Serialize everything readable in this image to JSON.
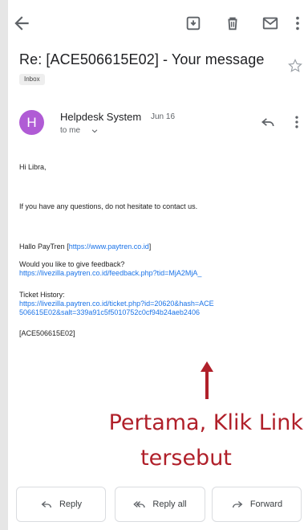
{
  "subject": "Re: [ACE506615E02] - Your message",
  "label": "Inbox",
  "sender": {
    "initial": "H",
    "name": "Helpdesk System",
    "date": "Jun 16",
    "to": "to me"
  },
  "body": {
    "greeting": "Hi Libra,",
    "line1": "If you have any questions, do not hesitate to contact us.",
    "hallo_prefix": "Hallo PayTren [",
    "hallo_link": "https://www.paytren.co.id",
    "hallo_suffix": "]",
    "feedback_label": "Would you like to give feedback?",
    "feedback_link": "https://livezilla.paytren.co.id/feedback.php?tid=MjA2MjA_",
    "history_label": "Ticket History:",
    "history_link_1": "https://livezilla.paytren.co.id/ticket.php?id=20620&hash=ACE",
    "history_link_2": "506615E02&salt=339a91c5f5010752c0cf94b24aeb2406",
    "ticket_tag": "[ACE506615E02]"
  },
  "annotation": {
    "line1": "Pertama, Klik Link",
    "line2": "tersebut",
    "color": "#b0202a"
  },
  "actions": {
    "reply": "Reply",
    "reply_all": "Reply all",
    "forward": "Forward"
  },
  "colors": {
    "avatar": "#b05bd5",
    "link": "#1a73e8"
  }
}
